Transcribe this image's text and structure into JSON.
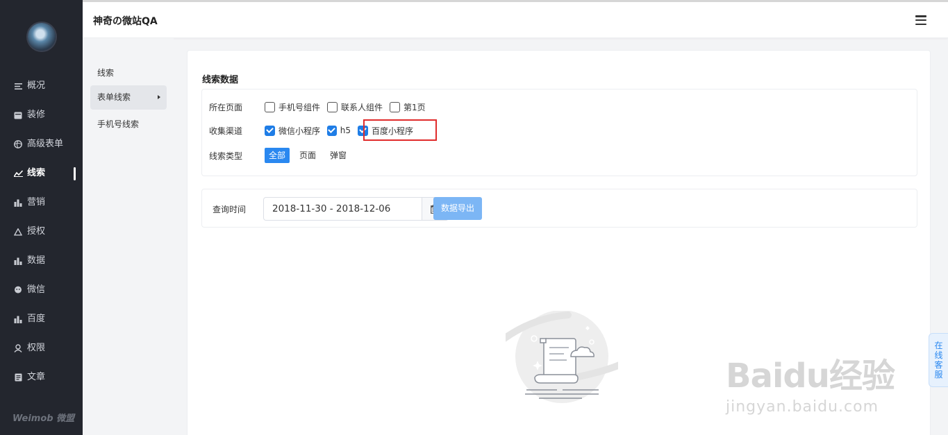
{
  "app": {
    "title": "神奇の微站QA",
    "brand": "Weimob 微盟"
  },
  "sidebar": {
    "items": [
      {
        "label": "概况",
        "icon": "list-icon"
      },
      {
        "label": "装修",
        "icon": "box-icon"
      },
      {
        "label": "高级表单",
        "icon": "ball-icon"
      },
      {
        "label": "线索",
        "icon": "trend-icon",
        "active": true
      },
      {
        "label": "营销",
        "icon": "bar-chart-icon"
      },
      {
        "label": "授权",
        "icon": "recycle-icon"
      },
      {
        "label": "数据",
        "icon": "bar-chart-icon"
      },
      {
        "label": "微信",
        "icon": "chat-icon"
      },
      {
        "label": "百度",
        "icon": "bar-chart-icon"
      },
      {
        "label": "权限",
        "icon": "user-icon"
      },
      {
        "label": "文章",
        "icon": "document-icon"
      }
    ]
  },
  "subnav": {
    "group": "线索",
    "items": [
      {
        "label": "表单线索",
        "active": true
      },
      {
        "label": "手机号线索"
      }
    ]
  },
  "main": {
    "section_title": "线索数据",
    "filters": {
      "page": {
        "label": "所在页面",
        "options": [
          {
            "label": "手机号组件",
            "checked": false
          },
          {
            "label": "联系人组件",
            "checked": false
          },
          {
            "label": "第1页",
            "checked": false
          }
        ]
      },
      "channel": {
        "label": "收集渠道",
        "options": [
          {
            "label": "微信小程序",
            "checked": true
          },
          {
            "label": "h5",
            "checked": true
          },
          {
            "label": "百度小程序",
            "checked": true
          }
        ]
      },
      "type": {
        "label": "线索类型",
        "options": [
          "全部",
          "页面",
          "弹窗"
        ],
        "active": "全部"
      }
    },
    "query": {
      "label": "查询时间",
      "date_range": "2018-11-30 - 2018-12-06",
      "export_label": "数据导出"
    }
  },
  "float_service": [
    "在",
    "线",
    "客",
    "服"
  ],
  "watermark": {
    "big": "Baidu经验",
    "small": "jingyan.baidu.com"
  },
  "colors": {
    "sidebar_bg": "#23262e",
    "primary": "#2a88f0",
    "export_btn": "#7cb6f5",
    "highlight": "#e02b2b"
  }
}
